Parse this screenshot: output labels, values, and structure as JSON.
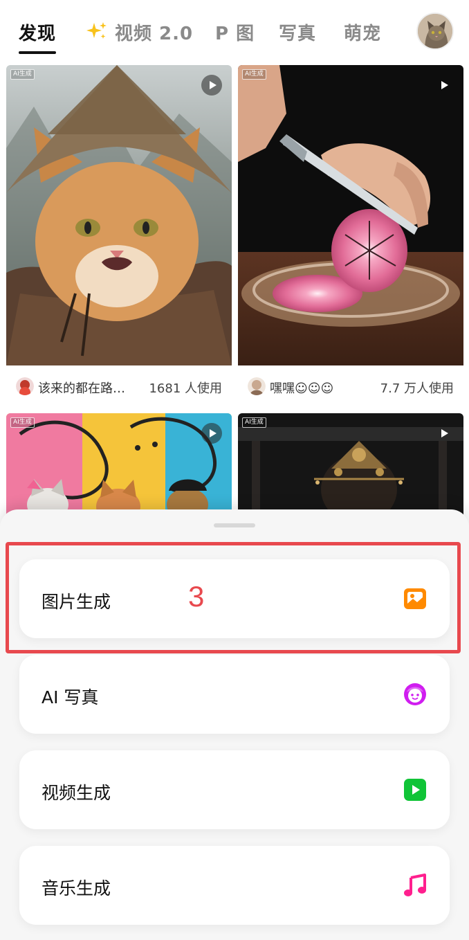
{
  "tabs": [
    {
      "label": "发现",
      "active": true
    },
    {
      "label": "视频 2.0",
      "active": false,
      "icon": "sparkles-icon"
    },
    {
      "label": "P 图",
      "active": false
    },
    {
      "label": "写真",
      "active": false
    },
    {
      "label": "萌宠",
      "active": false
    }
  ],
  "cards": [
    {
      "tag": "AI生成",
      "author": "该来的都在路…",
      "usage": "1681 人使用",
      "has_video": true
    },
    {
      "tag": "AI生成",
      "author": "嘿嘿☺☺☺",
      "usage": "7.7 万人使用",
      "has_video": true
    },
    {
      "tag": "AI生成",
      "has_video": true
    },
    {
      "tag": "AI生成",
      "has_video": true
    }
  ],
  "sheet": {
    "options": [
      {
        "label": "图片生成",
        "icon": "image-icon",
        "color": "#ff8a00"
      },
      {
        "label": "AI 写真",
        "icon": "face-icon",
        "color": "#d01df0"
      },
      {
        "label": "视频生成",
        "icon": "video-play-icon",
        "color": "#10c437"
      },
      {
        "label": "音乐生成",
        "icon": "music-note-icon",
        "color": "#ff1f8e"
      }
    ]
  },
  "annotation": {
    "number": "3",
    "color": "#e8494e"
  }
}
